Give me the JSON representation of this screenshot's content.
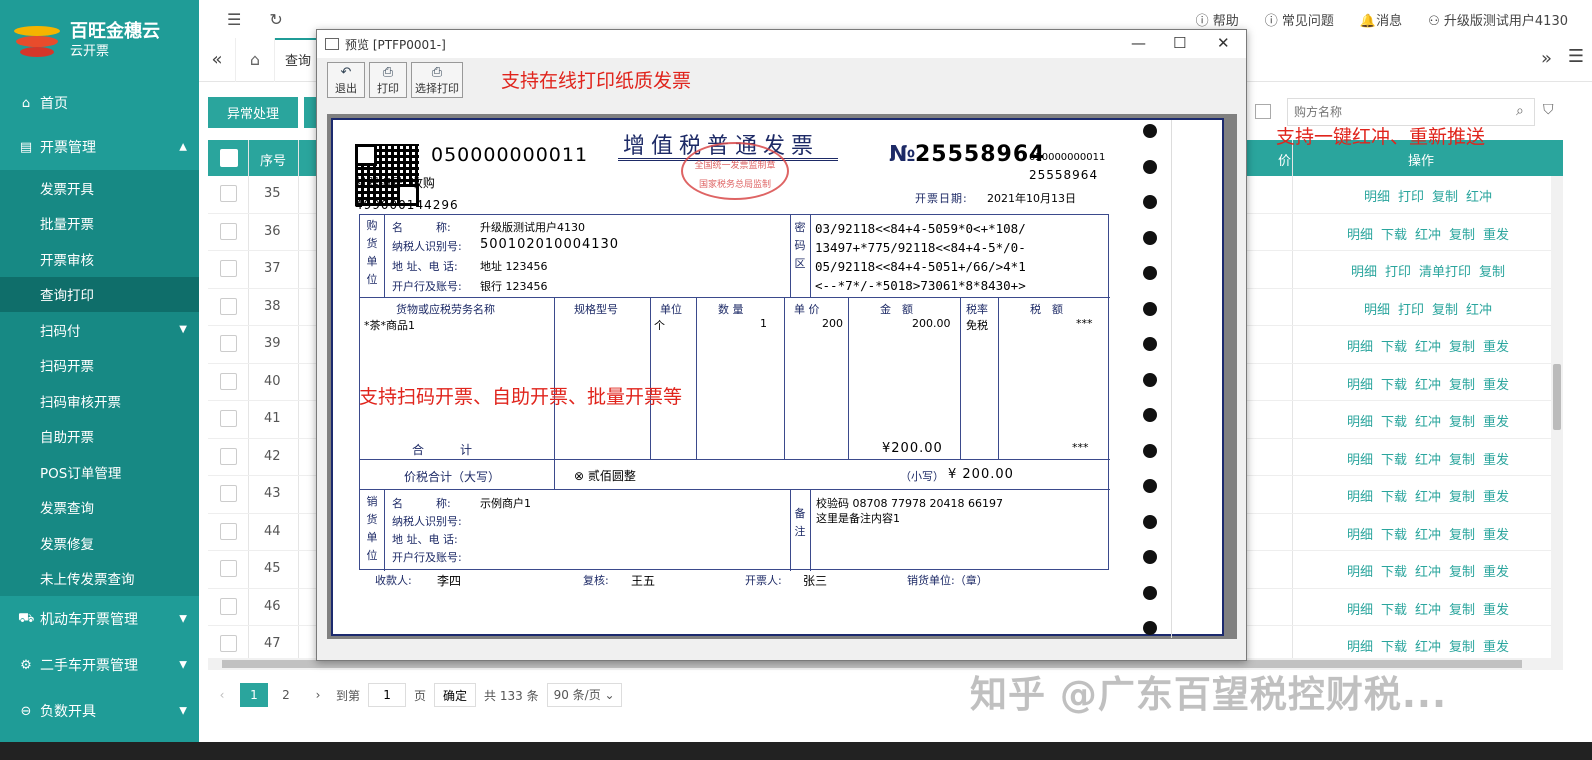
{
  "app": {
    "brand": "百旺金穗云",
    "sub": "云开票"
  },
  "sidebar": {
    "home": "首页",
    "groups": [
      {
        "label": "开票管理",
        "caret": "▲"
      },
      {
        "label": "扫码付",
        "caret": "▼"
      },
      {
        "label": "机动车开票管理",
        "caret": "▼"
      },
      {
        "label": "二手车开票管理",
        "caret": "▼"
      },
      {
        "label": "负数开具",
        "caret": "▼"
      }
    ],
    "invoice_items": [
      "发票开具",
      "批量开票",
      "开票审核",
      "查询打印"
    ],
    "scan_items": [
      "扫码开票",
      "扫码审核开票",
      "自助开票",
      "POS订单管理",
      "发票查询",
      "发票修复",
      "未上传发票查询"
    ]
  },
  "topbar": {
    "help": "帮助",
    "faq": "常见问题",
    "messages": "消息",
    "user": "升级版测试用户4130"
  },
  "tabs": {
    "active": "查询"
  },
  "toolbar": {
    "abnormal": "异常处理",
    "buyer_placeholder": "购方名称"
  },
  "table": {
    "headers": {
      "seq": "序号",
      "price": "价",
      "op": "操作"
    },
    "rows": [
      {
        "seq": "35",
        "ops": [
          "明细",
          "打印",
          "复制",
          "红冲"
        ]
      },
      {
        "seq": "36",
        "ops": [
          "明细",
          "下载",
          "红冲",
          "复制",
          "重发"
        ]
      },
      {
        "seq": "37",
        "ops": [
          "明细",
          "打印",
          "清单打印",
          "复制"
        ]
      },
      {
        "seq": "38",
        "ops": [
          "明细",
          "打印",
          "复制",
          "红冲"
        ]
      },
      {
        "seq": "39",
        "ops": [
          "明细",
          "下载",
          "红冲",
          "复制",
          "重发"
        ]
      },
      {
        "seq": "40",
        "ops": [
          "明细",
          "下载",
          "红冲",
          "复制",
          "重发"
        ]
      },
      {
        "seq": "41",
        "ops": [
          "明细",
          "下载",
          "红冲",
          "复制",
          "重发"
        ]
      },
      {
        "seq": "42",
        "ops": [
          "明细",
          "下载",
          "红冲",
          "复制",
          "重发"
        ]
      },
      {
        "seq": "43",
        "ops": [
          "明细",
          "下载",
          "红冲",
          "复制",
          "重发"
        ]
      },
      {
        "seq": "44",
        "ops": [
          "明细",
          "下载",
          "红冲",
          "复制",
          "重发"
        ]
      },
      {
        "seq": "45",
        "ops": [
          "明细",
          "下载",
          "红冲",
          "复制",
          "重发"
        ]
      },
      {
        "seq": "46",
        "ops": [
          "明细",
          "下载",
          "红冲",
          "复制",
          "重发"
        ]
      },
      {
        "seq": "47",
        "ops": [
          "明细",
          "下载",
          "红冲",
          "复制",
          "重发"
        ]
      }
    ]
  },
  "pager": {
    "pages": [
      "1",
      "2"
    ],
    "goto_label": "到第",
    "goto_value": "1",
    "page_unit": "页",
    "confirm": "确定",
    "total": "共 133 条",
    "page_size": "90 条/页"
  },
  "annotations": {
    "print": "支持在线打印纸质发票",
    "redo": "支持一键红冲、重新推送",
    "scan": "支持扫码开票、自助开票、批量开票等"
  },
  "watermark": "知乎 @广东百望税控财税...",
  "preview": {
    "title": "预览 [PTFP0001-]",
    "tools": [
      "退出",
      "打印",
      "选择打印"
    ]
  },
  "invoice": {
    "code": "050000000011",
    "machine": "机器编号: 收购",
    "check_num": "499000144296",
    "title": "增值税普通发票",
    "seal_top": "全国统一发票监制章",
    "seal_bottom": "国家税务总局监制",
    "no_symbol": "№",
    "number": "25558964",
    "no_code": "050000000011",
    "no_num": "25558964",
    "date_label": "开票日期:",
    "date": "2021年10月13日",
    "buyer_side": "购货单位",
    "buyer_labels": [
      "名　　　称:",
      "纳税人识别号:",
      "地 址、电 话:",
      "开户行及账号:"
    ],
    "buyer_values": [
      "升级版测试用户4130",
      "500102010004130",
      "地址 123456",
      "银行 123456"
    ],
    "cipher_side": "密码区",
    "cipher": [
      "03/92118<<84+4-5059*0<+*108/",
      "13497+*775/92118<<84+4-5*/0-",
      "05/92118<<84+4-5051+/66/>4*1",
      "<--*7*/-*5018>73061*8*8430+>"
    ],
    "item_headers": [
      "货物或应税劳务名称",
      "规格型号",
      "单位",
      "数 量",
      "单 价",
      "金　额",
      "税率",
      "税　额"
    ],
    "item": {
      "name": "*茶*商品1",
      "unit": "个",
      "qty": "1",
      "price": "200",
      "amount": "200.00",
      "rate": "免税",
      "tax": "***"
    },
    "sum_label": "合　　　计",
    "sum_amount": "¥200.00",
    "sum_tax": "***",
    "total_label": "价税合计（大写）",
    "total_upper": "⊗ 贰佰圆整",
    "total_small_label": "（小写）",
    "total_small": "¥ 200.00",
    "seller_side": "销货单位",
    "seller_labels": [
      "名　　　称:",
      "纳税人识别号:",
      "地 址、电 话:",
      "开户行及账号:"
    ],
    "seller_name": "示例商户1",
    "remark_side": "备注",
    "remark_check": "校验码 08708 77978 20418 66197",
    "remark_text": "这里是备注内容1",
    "payee_label": "收款人:",
    "payee": "李四",
    "reviewer_label": "复核:",
    "reviewer": "王五",
    "drawer_label": "开票人:",
    "drawer": "张三",
    "seller_stamp": "销货单位:（章）"
  },
  "colors": {
    "brand": "#1f9c97",
    "accent": "#2aa59d",
    "annot": "#e0241c"
  }
}
